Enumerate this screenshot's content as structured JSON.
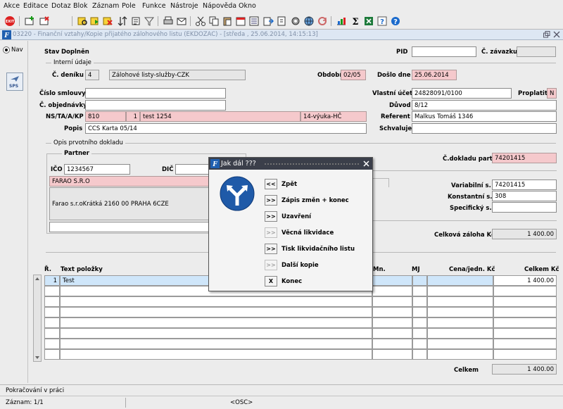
{
  "menu": [
    "Akce",
    "Editace",
    "Dotaz",
    "Blok",
    "Záznam",
    "Pole",
    "Funkce",
    "Nástroje",
    "Nápověda",
    "Okno"
  ],
  "toolbar_icons": [
    "exit-icon",
    "new-record-icon",
    "delete-record-icon",
    "enter-query-icon",
    "execute-query-icon",
    "cancel-query-icon",
    "sort-icon",
    "count-icon",
    "filter-icon",
    "print-icon",
    "email-icon",
    "cut-icon",
    "copy-icon",
    "paste-icon",
    "calendar-icon",
    "lov-icon",
    "export-icon",
    "attachment-icon",
    "settings-icon",
    "globe-icon",
    "recalc-icon",
    "chart-icon",
    "sum-icon",
    "excel-icon",
    "help-icon",
    "help-question-icon"
  ],
  "window": {
    "title": "03220 - Finanční vztahy/Kopie přijatého zálohového listu (EKDOZAC) - [středa , 25.06.2014, 14:15:13]"
  },
  "nav": {
    "label": "Nav",
    "sps_label": "SPS"
  },
  "form": {
    "stav_label": "Stav",
    "stav_value": "Doplněn",
    "pid_label": "PID",
    "pid_value": "",
    "c_zavazku_label": "Č. závazku",
    "c_zavazku_value": "",
    "interni_udaje_title": "Interní údaje",
    "c_deniku_label": "Č. deníku",
    "c_deniku_value": "4",
    "c_deniku_name": "Zálohové listy-služby-CZK",
    "obdobi_label": "Období",
    "obdobi_value": "02/05",
    "doslo_dne_label": "Došlo dne",
    "doslo_dne_value": "25.06.2014",
    "cislo_smlouvy_label": "Číslo smlouvy",
    "cislo_smlouvy_value": "",
    "vlastni_ucet_label": "Vlastní účet",
    "vlastni_ucet_value": "24828091/0100",
    "proplatit_label": "Proplatit",
    "proplatit_value": "N",
    "c_objednavky_label": "Č. objednávky",
    "c_objednavky_value": "",
    "duvod_label": "Důvod",
    "duvod_value": "8/12",
    "ns_label": "NS/TA/A/KP",
    "ns_value": "810",
    "ta_value": "1",
    "a_value": "test 1254",
    "kp_value": "14-výuka-HČ",
    "referent_label": "Referent",
    "referent_value": "Malkus Tomáš 1346",
    "popis_label": "Popis",
    "popis_value": "CCS Karta 05/14",
    "schvaluje_label": "Schvaluje",
    "schvaluje_value": "",
    "opis_title": "Opis prvotního dokladu",
    "partner_title": "Partner",
    "ico_label": "IČO",
    "ico_value": "1234567",
    "dic_label": "DIČ",
    "dic_value": "",
    "partner_name": "FARAO S.R.O",
    "partner_address": "Farao s.r.oKrátká 2160 00 PRAHA 6CZE",
    "partner_extra": "",
    "c_dokladu_label": "Č.dokladu part.",
    "c_dokladu_value": "74201415",
    "variabilni_label": "Variabilní s.",
    "variabilni_value": "74201415",
    "konstantni_label": "Konstantní s.",
    "konstantni_value": "308",
    "specificky_label": "Specifický s.",
    "specificky_value": "",
    "celkova_zaloha_label": "Celková záloha Kč",
    "celkova_zaloha_value": "1 400.00"
  },
  "grid": {
    "headers": {
      "r": "Ř.",
      "text": "Text položky",
      "mn": "Mn.",
      "mj": "MJ",
      "cena": "Cena/jedn. Kč",
      "celkem": "Celkem Kč"
    },
    "rows": [
      {
        "r": "1",
        "text": "Test",
        "mn": "",
        "mj": "",
        "cena": "",
        "celkem": "1 400.00"
      }
    ],
    "total_label": "Celkem",
    "total_value": "1 400.00"
  },
  "dialog": {
    "title": "Jak dál ???",
    "buttons": [
      {
        "key": "<<",
        "label": "Zpět",
        "enabled": true
      },
      {
        "key": ">>",
        "label": "Zápis změn + konec",
        "enabled": true
      },
      {
        "key": ">>",
        "label": "Uzavření",
        "enabled": true
      },
      {
        "key": ">>",
        "label": "Věcná likvidace",
        "enabled": false
      },
      {
        "key": ">>",
        "label": "Tisk likvidačního listu",
        "enabled": true
      },
      {
        "key": ">>",
        "label": "Další kopie",
        "enabled": false
      },
      {
        "key": "X",
        "label": "Konec",
        "enabled": true
      }
    ]
  },
  "status": {
    "message": "Pokračování v práci",
    "record": "Záznam: 1/1",
    "mode": "<OSC>"
  }
}
